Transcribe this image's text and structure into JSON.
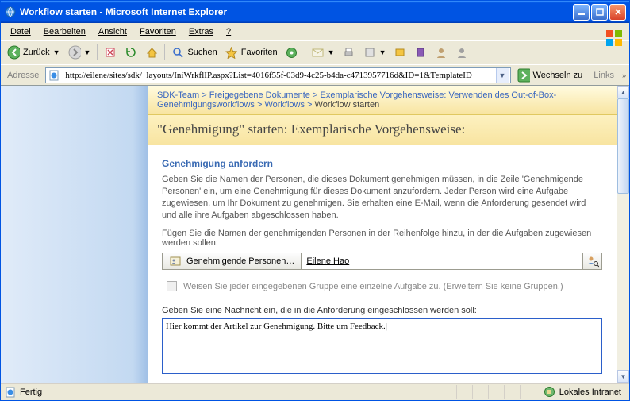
{
  "window": {
    "title": "Workflow starten - Microsoft Internet Explorer"
  },
  "menu": {
    "file": "Datei",
    "edit": "Bearbeiten",
    "view": "Ansicht",
    "favorites": "Favoriten",
    "extras": "Extras",
    "help": "?"
  },
  "toolbar": {
    "back": "Zurück",
    "search": "Suchen",
    "favorites": "Favoriten"
  },
  "address": {
    "label": "Adresse",
    "url": "http://eilene/sites/sdk/_layouts/IniWrkflIP.aspx?List=4016f55f-03d9-4c25-b4da-c4713957716d&ID=1&TemplateID",
    "go": "Wechseln zu",
    "links": "Links"
  },
  "breadcrumb": {
    "seg1": "SDK-Team",
    "seg2": "Freigegebene Dokumente",
    "seg3": "Exemplarische Vorgehensweise: Verwenden des Out-of-Box-Genehmigungsworkflows",
    "seg4": "Workflows",
    "seg5": "Workflow starten",
    "sep": " > "
  },
  "page": {
    "title": "\"Genehmigung\" starten: Exemplarische Vorgehensweise:"
  },
  "section": {
    "title": "Genehmigung anfordern",
    "help": "Geben Sie die Namen der Personen, die dieses Dokument genehmigen müssen, in die Zeile 'Genehmigende Personen' ein, um eine Genehmigung für dieses Dokument anzufordern.  Jeder Person wird eine Aufgabe zugewiesen, um Ihr Dokument zu genehmigen. Sie erhalten eine E-Mail, wenn die Anforderung gesendet wird und alle ihre Aufgaben abgeschlossen haben.",
    "hint": "Fügen Sie die Namen der genehmigenden Personen in der Reihenfolge hinzu, in der die Aufgaben zugewiesen werden sollen:",
    "people_button": "Genehmigende Personen…",
    "people_value": "Eilene Hao",
    "checkbox_label": "Weisen Sie jeder eingegebenen Gruppe eine einzelne Aufgabe zu. (Erweitern Sie keine Gruppen.)",
    "message_label": "Geben Sie eine Nachricht ein, die in die Anforderung eingeschlossen werden soll:",
    "message_value": "Hier kommt der Artikel zur Genehmigung. Bitte um Feedback."
  },
  "status": {
    "text": "Fertig",
    "zone": "Lokales Intranet"
  }
}
